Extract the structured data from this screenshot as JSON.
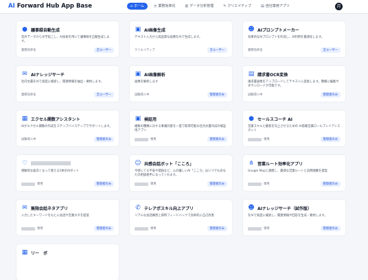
{
  "header": {
    "brand_ai": "AI",
    "brand_rest": " Forward Hub App Base",
    "nav": [
      {
        "label": "ホーム",
        "icon": "home-icon",
        "glyph": "⌂",
        "active": true
      },
      {
        "label": "業務効率化",
        "icon": "clock-icon",
        "glyph": "◷",
        "active": false
      },
      {
        "label": "データ分析管理",
        "icon": "chart-icon",
        "glyph": "▥",
        "active": false
      },
      {
        "label": "クリエイティブ",
        "icon": "pen-icon",
        "glyph": "✎",
        "active": false
      },
      {
        "label": "自社専用アプリ",
        "icon": "doc-icon",
        "glyph": "▤",
        "active": false
      }
    ],
    "avatar_initial": "月"
  },
  "cards": [
    {
      "title": "議事録自動生成",
      "icon": "mic-icon",
      "glyph": "●",
      "desc": "音声データから文字起こし、AI技術を用いて議事録を自動生成します。",
      "category": "業務効率化",
      "badge": "全ユーザー"
    },
    {
      "title": "AI画像生成",
      "icon": "image-icon",
      "glyph": "▣",
      "desc": "テキスト入力から高品質な画像をAIで生成します。",
      "category": "クリエイティブ",
      "badge": "全ユーザー"
    },
    {
      "title": "AIプロンプトメーカー",
      "icon": "robot-icon",
      "glyph": "☻",
      "desc": "効果的なAIプロンプトを作成し、AI利用を最適化します。",
      "category": "業務効率化",
      "badge": "全ユーザー"
    },
    {
      "title": "AIナレッジサーチ",
      "icon": "chat-icon",
      "glyph": "✉",
      "desc": "社内文書をAIで高度に検索し、関連情報を抽出・要約します。",
      "category": "業務効率化",
      "badge": "全ユーザー"
    },
    {
      "title": "AI画像解析",
      "icon": "image-icon",
      "glyph": "▣",
      "desc": "画像を解析します",
      "category": "試験導入中",
      "badge": "管理者のみ"
    },
    {
      "title": "請求書OCR変換",
      "icon": "document-icon",
      "glyph": "▤",
      "desc": "請求書画像をアップロードしてテキストに変換します。整備に編集やダウンロードが可能です。",
      "category": "試験導入中",
      "badge": "管理者のみ"
    },
    {
      "title": "エクセル関数アシスタント",
      "icon": "table-icon",
      "glyph": "▦",
      "desc": "AIがエクセル関数の作成をステップバイステップでサポートします。",
      "category": "試験導入中",
      "badge": "管理者のみ"
    },
    {
      "title": "検証用",
      "icon": "image-icon",
      "glyph": "▣",
      "desc": "複数の種類に対する事業同意を一度で取得可能な社内文書作成の検証用アプリ",
      "category": "",
      "badge": "管理者のみ"
    },
    {
      "title": "セールスコーチ AI",
      "icon": "person-icon",
      "glyph": "●",
      "desc": "営業スキルと顧客を向上させるための AI搭載営業ロールプレイアシスタント",
      "category": "",
      "badge": "管理者のみ"
    },
    {
      "title": "",
      "icon": "heart-icon",
      "glyph": "♡",
      "desc": "感動的な面白くなって使える2体のAIボット",
      "category": "",
      "badge": "管理者のみ"
    },
    {
      "title": "共感会話ボット「こころ」",
      "icon": "smile-icon",
      "glyph": "☺",
      "desc": "今感じてる不安や孤独など、心の優しいAI「こころ」はいつでもあなたの相談相手になってくれます。",
      "category": "",
      "badge": "管理者のみ"
    },
    {
      "title": "営業ルート効率化アプリ",
      "icon": "route-icon",
      "glyph": "⋔",
      "desc": "Google Mapと連携し、最適な営業ルートと訪問順番を提案",
      "category": "",
      "badge": "管理者のみ"
    },
    {
      "title": "無限会話ネタアプリ",
      "icon": "chat-icon",
      "glyph": "✉",
      "desc": "入力したキーワードをもとに会話や営業ネタを提案",
      "category": "",
      "badge": "管理者のみ"
    },
    {
      "title": "テレアポスキル向上アプリ",
      "icon": "phone-icon",
      "glyph": "✆",
      "desc": "リアルな会話練習と即時フィードバックで効率的に自己改善",
      "category": "",
      "badge": "管理者のみ"
    },
    {
      "title": "AIナレッジサーチ（試作版）",
      "icon": "robot-icon",
      "glyph": "☻",
      "desc": "をAIで高度に検索し、関連情報や回答を生成・要約します。",
      "category": "",
      "badge": "管理者のみ"
    }
  ],
  "category_shared": "専用",
  "partial_title": "リー　ボ"
}
